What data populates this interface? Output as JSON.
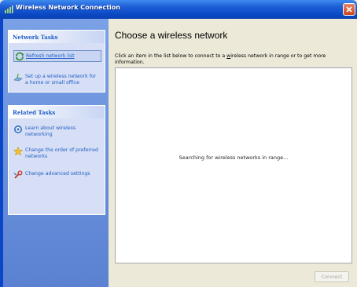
{
  "window": {
    "title": "Wireless Network Connection"
  },
  "sidebar": {
    "network_tasks": {
      "heading": "Network Tasks",
      "items": [
        {
          "label": "Refresh network list",
          "icon": "refresh-icon"
        },
        {
          "label": "Set up a wireless network for a home or small office",
          "icon": "setup-network-icon"
        }
      ]
    },
    "related_tasks": {
      "heading": "Related Tasks",
      "items": [
        {
          "label": "Learn about wireless networking",
          "icon": "help-icon"
        },
        {
          "label": "Change the order of preferred networks",
          "icon": "star-icon"
        },
        {
          "label": "Change advanced settings",
          "icon": "settings-icon"
        }
      ]
    }
  },
  "main": {
    "heading": "Choose a wireless network",
    "instructions_prefix": "Click an item in the list below to connect to a ",
    "instructions_link": "w",
    "instructions_suffix": "ireless network in range or to get more information.",
    "status": "Searching for wireless networks in range...",
    "connect_label": "Connect"
  },
  "colors": {
    "titlebar": "#0b4ac6",
    "sidebar": "#6a91db",
    "task_link": "#215dc6"
  }
}
